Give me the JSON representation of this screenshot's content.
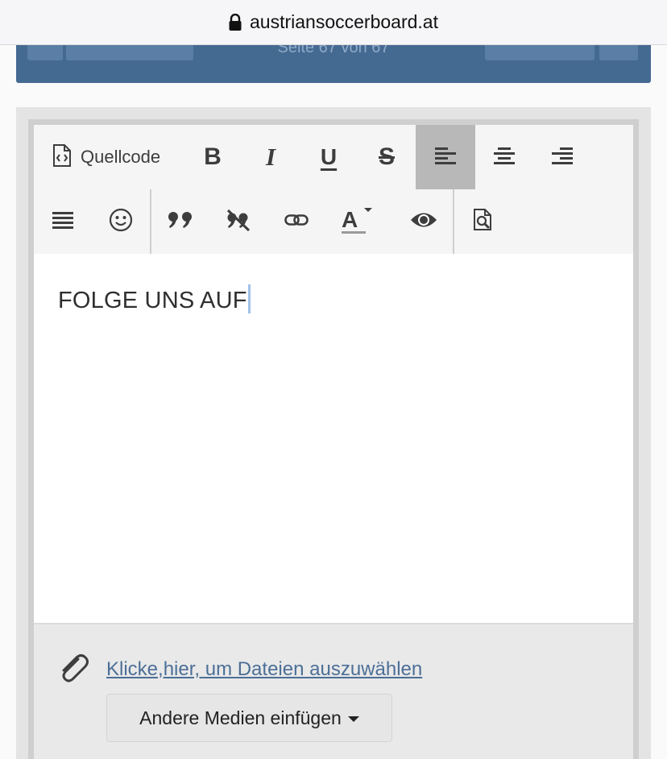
{
  "browser": {
    "url": "austriansoccerboard.at"
  },
  "page": {
    "pagination_text": "Seite 67 von 67"
  },
  "toolbar": {
    "source_label": "Quellcode",
    "buttons_row1": [
      {
        "name": "bold-button",
        "icon": "bold-icon"
      },
      {
        "name": "italic-button",
        "icon": "italic-icon"
      },
      {
        "name": "underline-button",
        "icon": "underline-icon"
      },
      {
        "name": "strikethrough-button",
        "icon": "strikethrough-icon"
      },
      {
        "name": "align-left-button",
        "icon": "align-left-icon",
        "active": true
      },
      {
        "name": "align-center-button",
        "icon": "align-center-icon"
      },
      {
        "name": "align-right-button",
        "icon": "align-right-icon"
      }
    ],
    "buttons_row2": [
      {
        "name": "justify-button",
        "icon": "justify-icon"
      },
      {
        "name": "emoji-button",
        "icon": "smiley-icon"
      },
      {
        "name": "quote-button",
        "icon": "quote-icon"
      },
      {
        "name": "remove-format-button",
        "icon": "remove-format-icon"
      },
      {
        "name": "link-button",
        "icon": "link-icon"
      },
      {
        "name": "text-color-button",
        "icon": "text-color-icon"
      },
      {
        "name": "preview-button",
        "icon": "eye-icon"
      },
      {
        "name": "preview-document-button",
        "icon": "document-search-icon"
      }
    ]
  },
  "editor": {
    "content": "FOLGE UNS AUF"
  },
  "attachments": {
    "link_text": "Klicke,hier, um Dateien auszuwählen",
    "media_button_label": "Andere Medien einfügen"
  },
  "colors": {
    "header_blue": "#456a92",
    "link": "#4c6f97",
    "active_button": "#b8b8b8",
    "caret": "#9fc2ea"
  }
}
